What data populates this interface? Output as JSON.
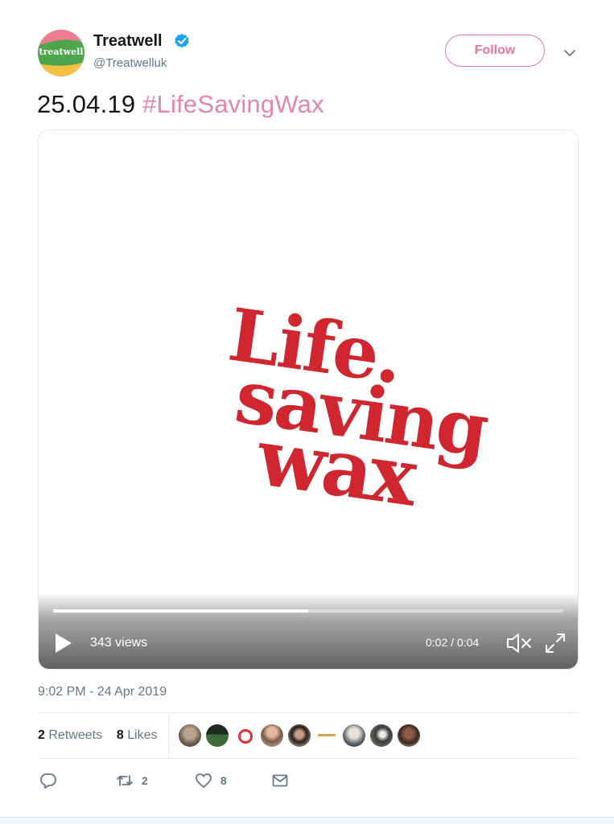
{
  "tweet": {
    "author_name": "Treatwell",
    "author_handle": "@Treatwelluk",
    "avatar_text": "treatwell",
    "verified": true,
    "follow_label": "Follow",
    "text_date": "25.04.19",
    "text_hashtag": "#LifeSavingWax",
    "hashtag_color": "#e487a6",
    "accent_color": "#e0799a"
  },
  "media": {
    "art_lines": [
      "Life.",
      "saving",
      "wax"
    ],
    "art_color": "#d0262f",
    "views": "343 views",
    "time": "0:02 / 0:04",
    "progress": 0.5
  },
  "meta": {
    "timestamp": "9:02 PM - 24 Apr 2019",
    "retweets_count": "2",
    "retweets_label": "Retweets",
    "likes_count": "8",
    "likes_label": "Likes"
  },
  "actions": {
    "reply_icon": "reply-icon",
    "retweet_icon": "retweet-icon",
    "retweet_count": "2",
    "like_icon": "heart-icon",
    "like_count": "8",
    "message_icon": "envelope-icon"
  }
}
